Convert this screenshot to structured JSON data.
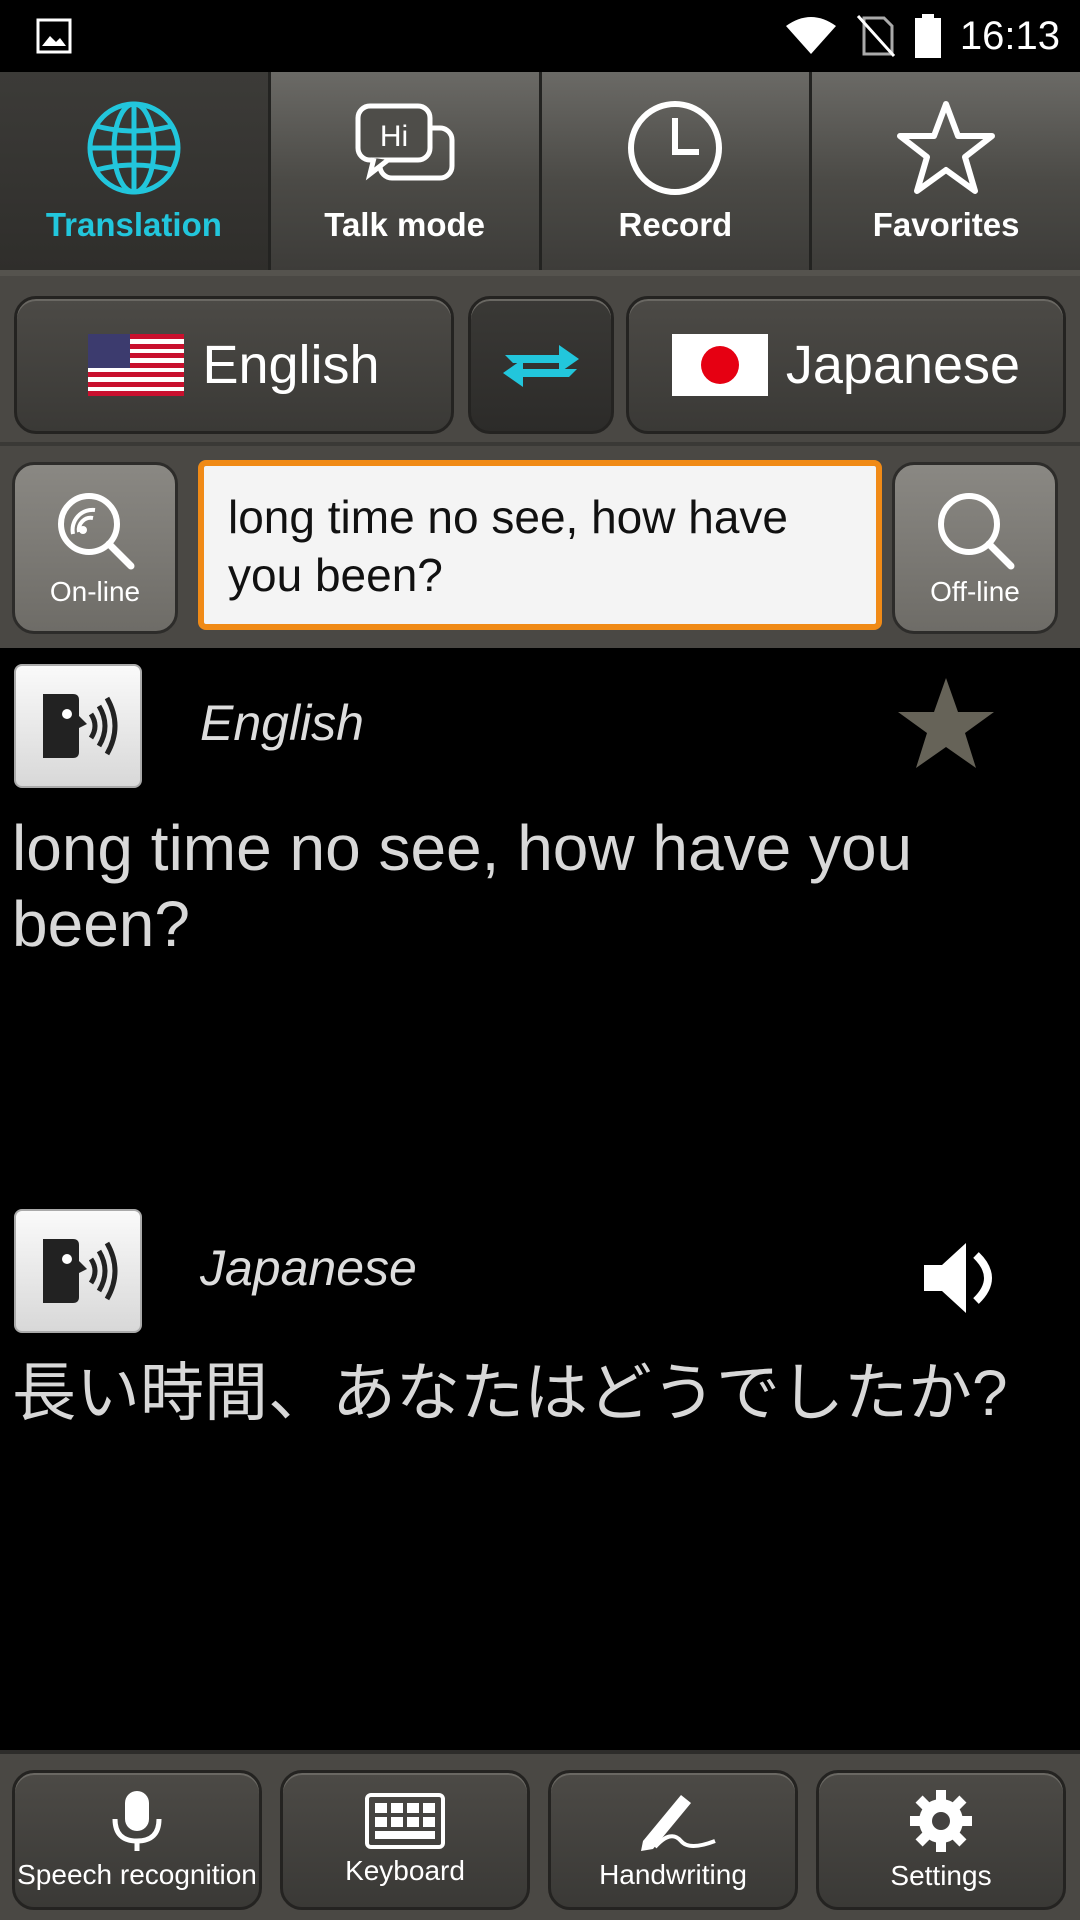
{
  "status_bar": {
    "time": "16:13",
    "left_icon": "image-icon",
    "right_icons": [
      "wifi-icon",
      "no-sim-icon",
      "battery-icon"
    ]
  },
  "tabs": [
    {
      "label": "Translation",
      "icon": "globe-icon",
      "active": true
    },
    {
      "label": "Talk mode",
      "icon": "speech-bubbles-icon",
      "active": false
    },
    {
      "label": "Record",
      "icon": "clock-icon",
      "active": false
    },
    {
      "label": "Favorites",
      "icon": "star-icon",
      "active": false
    }
  ],
  "languages": {
    "source": "English",
    "target": "Japanese"
  },
  "input": {
    "online_label": "On-line",
    "offline_label": "Off-line",
    "text": "long time no see, how have you been?"
  },
  "results": {
    "source": {
      "lang": "English",
      "text": "long time no see, how have you been?"
    },
    "target": {
      "lang": "Japanese",
      "text": "長い時間、あなたはどうでしたか?"
    }
  },
  "bottom_bar": [
    {
      "label": "Speech recognition",
      "icon": "microphone-icon"
    },
    {
      "label": "Keyboard",
      "icon": "keyboard-icon"
    },
    {
      "label": "Handwriting",
      "icon": "pen-icon"
    },
    {
      "label": "Settings",
      "icon": "gear-icon"
    }
  ],
  "colors": {
    "accent": "#22c6dc",
    "input_border": "#f08a16"
  }
}
